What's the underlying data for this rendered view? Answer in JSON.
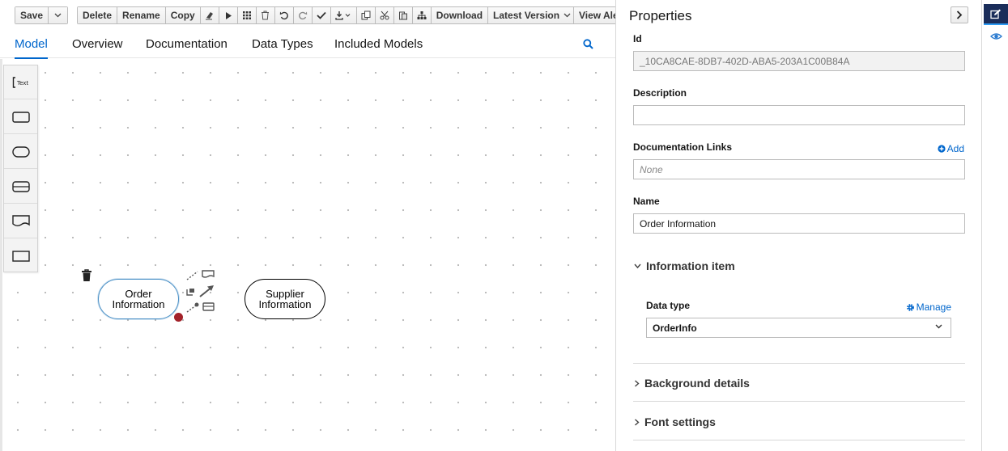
{
  "toolbar": {
    "save": "Save",
    "delete": "Delete",
    "rename": "Rename",
    "copy": "Copy",
    "download": "Download",
    "latest_version": "Latest Version",
    "view_alerts": "View Ale"
  },
  "tabs": [
    {
      "label": "Model",
      "active": true
    },
    {
      "label": "Overview"
    },
    {
      "label": "Documentation"
    },
    {
      "label": "Data Types"
    },
    {
      "label": "Included Models"
    }
  ],
  "canvas": {
    "palette_tools": [
      "text-annotation",
      "decision",
      "input-data",
      "business-knowledge-model",
      "knowledge-source",
      "decision-service"
    ],
    "nodes": {
      "order": "Order Information",
      "supplier": "Supplier Information"
    }
  },
  "properties": {
    "title": "Properties",
    "id_label": "Id",
    "id_value": "_10CA8CAE-8DB7-402D-ABA5-203A1C00B84A",
    "description_label": "Description",
    "description_value": "",
    "doc_links_label": "Documentation Links",
    "doc_links_add": "Add",
    "doc_links_placeholder": "None",
    "name_label": "Name",
    "name_value": "Order Information",
    "information_item": "Information item",
    "data_type_label": "Data type",
    "data_type_manage": "Manage",
    "data_type_value": "OrderInfo",
    "background_details": "Background details",
    "font_settings": "Font settings"
  },
  "colors": {
    "accent": "#0066cc",
    "rail_active": "#1a2d5a",
    "selected_node_border": "#4a90c6",
    "handle": "#a3222a"
  }
}
